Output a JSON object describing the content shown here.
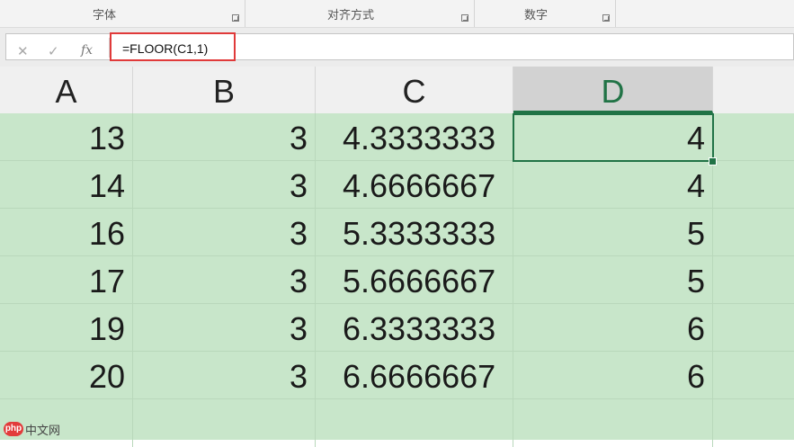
{
  "ribbon": {
    "groups": [
      {
        "label": "字体"
      },
      {
        "label": "对齐方式"
      },
      {
        "label": "数字"
      }
    ]
  },
  "formula_bar": {
    "cancel_glyph": "✕",
    "enter_glyph": "✓",
    "fx_glyph": "fx",
    "formula": "=FLOOR(C1,1)"
  },
  "columns": [
    "A",
    "B",
    "C",
    "D"
  ],
  "selected_column": "D",
  "rows": [
    [
      "13",
      "3",
      "4.3333333",
      "4"
    ],
    [
      "14",
      "3",
      "4.6666667",
      "4"
    ],
    [
      "16",
      "3",
      "5.3333333",
      "5"
    ],
    [
      "17",
      "3",
      "5.6666667",
      "5"
    ],
    [
      "19",
      "3",
      "6.3333333",
      "6"
    ],
    [
      "20",
      "3",
      "6.6666667",
      "6"
    ]
  ],
  "active_cell": "D1",
  "watermark": {
    "badge": "php",
    "text": "中文网"
  },
  "colors": {
    "accent": "#217346",
    "highlight_border": "#e03a3a",
    "grid_fill": "#c8e6ca"
  }
}
